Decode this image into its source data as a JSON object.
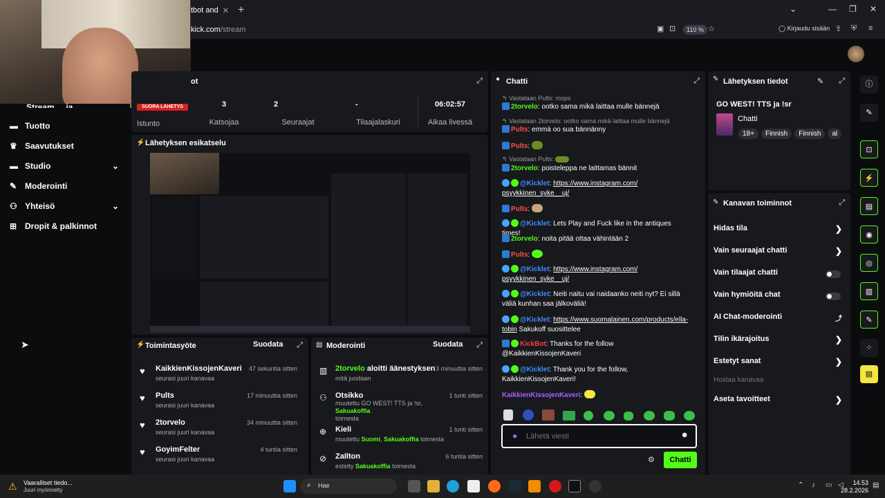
{
  "browser": {
    "tab_title": "tbot and",
    "url_prefix": "kick.com",
    "url_path": "/stream",
    "zoom": "110 %",
    "login": "Kirjaudu sisään"
  },
  "sidebar": {
    "partial_top": "Stream ... ja ...",
    "items": [
      {
        "label": "Tuotto"
      },
      {
        "label": "Saavutukset"
      },
      {
        "label": "Studio"
      },
      {
        "label": "Moderointi"
      },
      {
        "label": "Yhteisö"
      },
      {
        "label": "Dropit & palkinnot"
      }
    ]
  },
  "stats": {
    "title": "ot",
    "live_badge": "SUORA LÄHETYS",
    "session_label": "Istunto",
    "items": [
      {
        "value": "3",
        "label": "Katsojaa"
      },
      {
        "value": "2",
        "label": "Seuraajat"
      },
      {
        "value": "-",
        "label": "Tilaajalaskuri"
      },
      {
        "value": "06:02:57",
        "label": "Aikaa livessä"
      }
    ]
  },
  "preview": {
    "title": "Lähetyksen esikatselu"
  },
  "activity": {
    "title": "Toimintasyöte",
    "filter": "Suodata",
    "items": [
      {
        "name": "KaikkienKissojenKaveri",
        "time": "47 sekuntia sitten",
        "sub": "seurasi juuri kanavaa"
      },
      {
        "name": "Pults",
        "time": "17 minuuttia sitten",
        "sub": "seurasi juuri kanavaa"
      },
      {
        "name": "2torvelo",
        "time": "34 minuuttia sitten",
        "sub": "seurasi juuri kanavaa"
      },
      {
        "name": "GoyimFelter",
        "time": "4 tuntia sitten",
        "sub": "seurasi juuri kanavaa"
      }
    ]
  },
  "moderation": {
    "title": "Moderointi",
    "filter": "Suodata",
    "items": [
      {
        "name": "2torvelo",
        "action": " aloitti äänestyksen",
        "time": "3 minuuttia sitten",
        "sub": "mitä juodaan"
      },
      {
        "name": "Otsikko",
        "time": "1 tunti sitten",
        "sub_pre": "muutettu GO WEST! TTS ja !sr, ",
        "sub_user": "Sakuakoffia",
        "sub_post": " toimesta"
      },
      {
        "name": "Kieli",
        "time": "1 tunti sitten",
        "sub_pre": "muutettu ",
        "sub_val": "Suomi",
        "sub_user": "Sakuakoffia",
        "sub_post": " toimesta"
      },
      {
        "name": "ZaIlton",
        "time": "6 tuntia sitten",
        "sub_pre": "estetty ",
        "sub_user": "Sakuakoffia",
        "sub_post": " toimesta"
      }
    ]
  },
  "chat": {
    "title": "Chatti",
    "placeholder": "Lähetä viesti",
    "send": "Chatti",
    "lines": [
      {
        "reply": "Vastataan Pults: mops"
      },
      {
        "user": "2torvelo",
        "text": ": ootko sama mikä laittaa mulle bännejä"
      },
      {
        "reply": "Vastataan 2torvelo: ootko sama mikä laittaa mulle bännejä"
      },
      {
        "user": "Pults",
        "text": ": emmä oo sua bännänny"
      },
      {
        "user": "Pults",
        "text": ":"
      },
      {
        "reply": "Vastataan Pults:"
      },
      {
        "user": "2torvelo",
        "text": ": poisteleppa ne laittamas bännit"
      },
      {
        "user": "@Kicklet",
        "text": ": ",
        "link": "https://www.instagram.com/",
        "link2": "psyykkinen_syke__uj/"
      },
      {
        "user": "Pults",
        "text": ":"
      },
      {
        "user": "@Kicklet",
        "text": ": Lets Play and Fuck like in the antiques times!"
      },
      {
        "user": "2torvelo",
        "text": ": noita pitää ottaa vähintään 2"
      },
      {
        "user": "Pults",
        "text": ":"
      },
      {
        "user": "@Kicklet",
        "text": ": ",
        "link": "https://www.instagram.com/",
        "link2": "psyykkinen_syke__uj/"
      },
      {
        "user": "@Kicklet",
        "text": ": Neiti naitu vai naidaanko neiti nyt? Ei sillä",
        "text2": "väliä kunhan saa jälkoväliä!"
      },
      {
        "user": "@Kicklet",
        "text": ": ",
        "link": "https://www.suomalainen.com/products/ella-",
        "link2": "tobin",
        "after": " Sakukoff suosittelee"
      },
      {
        "user": "KickBot",
        "text": ": Thanks for the follow",
        "text2": "@KaikkienKissojenKaveri"
      },
      {
        "user": "@Kicklet",
        "text": ": Thank you for the follow,",
        "text2": "KaikkienKissojenKaveri!"
      },
      {
        "user": "KaikkienKissojenKaveri",
        "text": ":"
      }
    ]
  },
  "stream_info": {
    "title": "Lähetyksen tiedot",
    "stream_title": "GO WEST! TTS ja !sr",
    "category": "Chatti",
    "tags": [
      "18+",
      "Finnish",
      "Finnish",
      "al"
    ]
  },
  "channel_actions": {
    "title": "Kanavan toiminnot",
    "items": [
      {
        "label": "Hidas tila",
        "kind": "arrow"
      },
      {
        "label": "Vain seuraajat chatti",
        "kind": "arrow"
      },
      {
        "label": "Vain tilaajat chatti",
        "kind": "toggle"
      },
      {
        "label": "Vain hymiöitä chat",
        "kind": "toggle"
      },
      {
        "label": "AI Chat-moderointi",
        "kind": "external"
      },
      {
        "label": "Tilin ikärajoitus",
        "kind": "arrow"
      },
      {
        "label": "Estetyt sanat",
        "kind": "arrow"
      },
      {
        "label": "Hostaa kanavaa",
        "kind": "disabled"
      },
      {
        "label": "Aseta tavoitteet",
        "kind": "arrow"
      }
    ]
  },
  "notification": {
    "title": "Vaaralliset tiedo...",
    "sub": "Juuri myönnetty"
  },
  "taskbar": {
    "search": "Hae",
    "time": "14.53",
    "date": "28.2.2026"
  },
  "colors": {
    "accent": "#53fc18",
    "panel": "#18191d",
    "bg": "#0b0c0e"
  }
}
